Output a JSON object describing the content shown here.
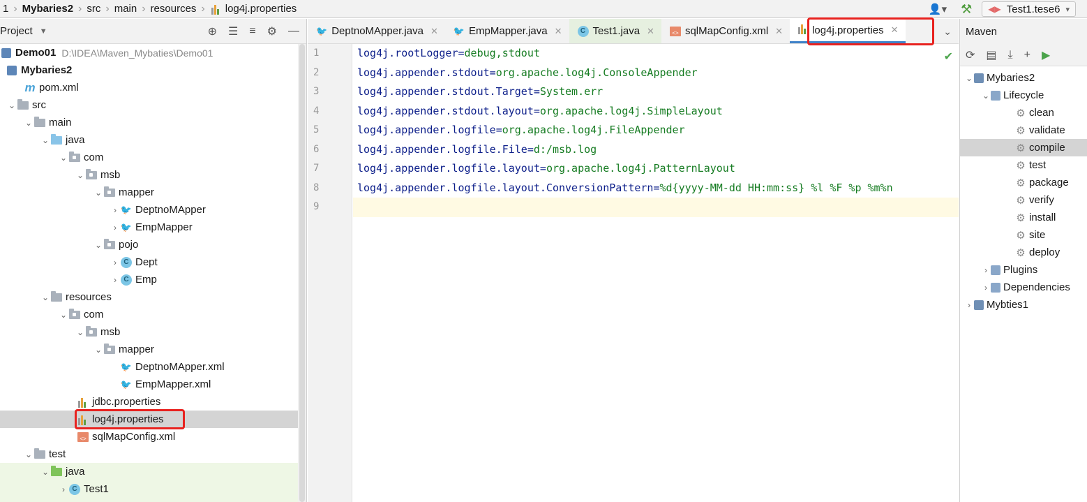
{
  "breadcrumb": {
    "items": [
      "1",
      "Mybaries2",
      "src",
      "main",
      "resources",
      "log4j.properties"
    ]
  },
  "toolbar": {
    "run_config": "Test1.tese6"
  },
  "project_panel": {
    "title": "Project",
    "tree": [
      {
        "label": "Demo01",
        "path": "D:\\IDEA\\Maven_Mybaties\\Demo01"
      },
      {
        "label": "Mybaries2"
      },
      {
        "label": "pom.xml"
      },
      {
        "label": "src"
      },
      {
        "label": "main"
      },
      {
        "label": "java"
      },
      {
        "label": "com"
      },
      {
        "label": "msb"
      },
      {
        "label": "mapper"
      },
      {
        "label": "DeptnoMApper"
      },
      {
        "label": "EmpMapper"
      },
      {
        "label": "pojo"
      },
      {
        "label": "Dept"
      },
      {
        "label": "Emp"
      },
      {
        "label": "resources"
      },
      {
        "label": "com"
      },
      {
        "label": "msb"
      },
      {
        "label": "mapper"
      },
      {
        "label": "DeptnoMApper.xml"
      },
      {
        "label": "EmpMapper.xml"
      },
      {
        "label": "jdbc.properties"
      },
      {
        "label": "log4j.properties"
      },
      {
        "label": "sqlMapConfig.xml"
      },
      {
        "label": "test"
      },
      {
        "label": "java"
      },
      {
        "label": "Test1"
      }
    ]
  },
  "editor": {
    "tabs": [
      {
        "label": "DeptnoMApper.java"
      },
      {
        "label": "EmpMapper.java"
      },
      {
        "label": "Test1.java"
      },
      {
        "label": "sqlMapConfig.xml"
      },
      {
        "label": "log4j.properties"
      }
    ],
    "line_numbers": [
      "1",
      "2",
      "3",
      "4",
      "5",
      "6",
      "7",
      "8",
      "9"
    ],
    "lines": [
      {
        "key": "log4j.rootLogger",
        "eq": "=",
        "value": "debug,stdout"
      },
      {
        "key": "log4j.appender.stdout",
        "eq": "=",
        "value": "org.apache.log4j.ConsoleAppender"
      },
      {
        "key": "log4j.appender.stdout.Target",
        "eq": "=",
        "value": "System.err"
      },
      {
        "key": "log4j.appender.stdout.layout",
        "eq": "=",
        "value": "org.apache.log4j.SimpleLayout"
      },
      {
        "key": "log4j.appender.logfile",
        "eq": "=",
        "value": "org.apache.log4j.FileAppender"
      },
      {
        "key": "log4j.appender.logfile.File",
        "eq": "=",
        "value": "d:/msb.log"
      },
      {
        "key": "log4j.appender.logfile.layout",
        "eq": "=",
        "value": "org.apache.log4j.PatternLayout"
      },
      {
        "key": "log4j.appender.logfile.layout.ConversionPattern",
        "eq": "=",
        "value": "%d{yyyy-MM-dd HH:mm:ss} %l %F %p %m%n"
      },
      {
        "key": "",
        "eq": "",
        "value": ""
      }
    ]
  },
  "maven": {
    "title": "Maven",
    "tree": [
      {
        "label": "Mybaries2"
      },
      {
        "label": "Lifecycle"
      },
      {
        "label": "clean"
      },
      {
        "label": "validate"
      },
      {
        "label": "compile"
      },
      {
        "label": "test"
      },
      {
        "label": "package"
      },
      {
        "label": "verify"
      },
      {
        "label": "install"
      },
      {
        "label": "site"
      },
      {
        "label": "deploy"
      },
      {
        "label": "Plugins"
      },
      {
        "label": "Dependencies"
      },
      {
        "label": "Mybties1"
      }
    ]
  },
  "colors": {
    "highlight_box": "#e8221f",
    "active_tab_underline": "#4083c9",
    "property_key": "#0d1f8a",
    "property_value": "#167c22"
  }
}
